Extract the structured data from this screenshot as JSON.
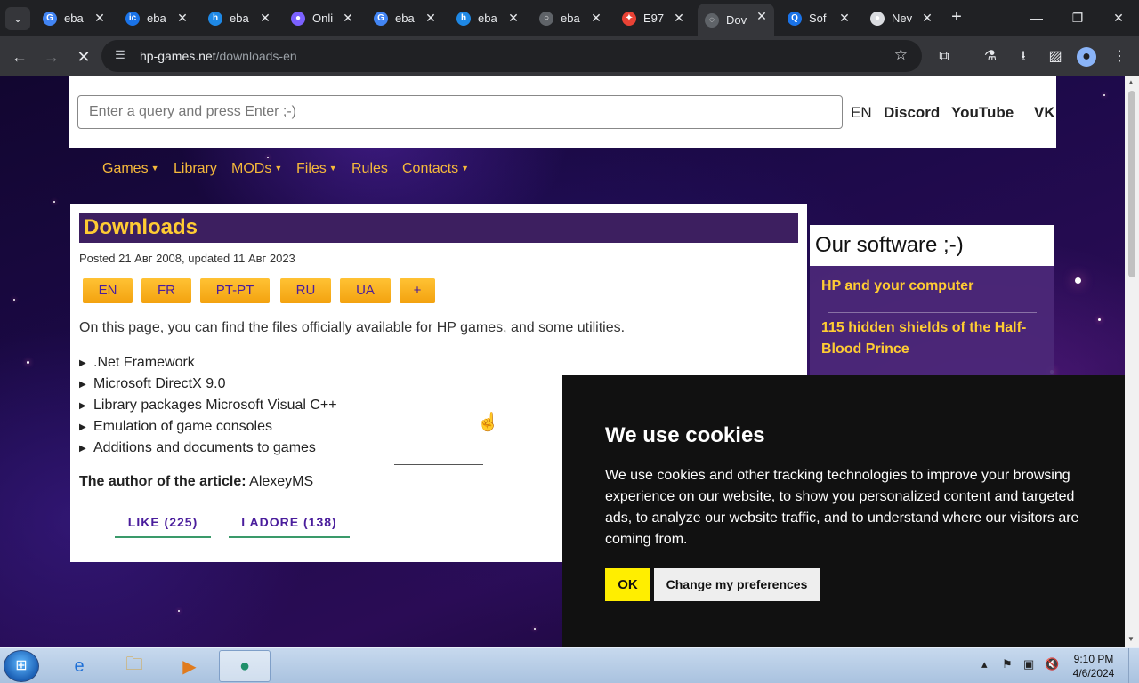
{
  "browser": {
    "tabs": [
      {
        "title": "eba",
        "icon": "google-icon",
        "color": "#4285f4",
        "glyph": "G"
      },
      {
        "title": "eba",
        "icon": "ic-icon",
        "color": "#1a73e8",
        "glyph": "ic"
      },
      {
        "title": "eba",
        "icon": "h-icon",
        "color": "#1e88e5",
        "glyph": "h"
      },
      {
        "title": "Onli",
        "icon": "onl-icon",
        "color": "#7b61ff",
        "glyph": "●"
      },
      {
        "title": "eba",
        "icon": "google-icon",
        "color": "#4285f4",
        "glyph": "G"
      },
      {
        "title": "eba",
        "icon": "h-icon",
        "color": "#1e88e5",
        "glyph": "h"
      },
      {
        "title": "eba",
        "icon": "globe-icon",
        "color": "#5f6368",
        "glyph": "○"
      },
      {
        "title": "E97",
        "icon": "pinwheel-icon",
        "color": "#e94235",
        "glyph": "✦"
      },
      {
        "title": "Dov",
        "icon": "loading-icon",
        "color": "#5f6368",
        "glyph": "◌",
        "active": true
      },
      {
        "title": "Sof",
        "icon": "q-icon",
        "color": "#1a73e8",
        "glyph": "Q"
      },
      {
        "title": "Nev",
        "icon": "chat-icon",
        "color": "#dadce0",
        "glyph": "●"
      }
    ],
    "url_domain": "hp-games.net",
    "url_path": "/downloads-en",
    "window_controls": {
      "minimize": "—",
      "restore": "❐",
      "close": "✕"
    }
  },
  "site": {
    "search_placeholder": "Enter a query and press Enter ;-)",
    "top_links": [
      "EN",
      "Discord",
      "YouTube",
      "VK"
    ],
    "menu": [
      {
        "label": "Games",
        "caret": true
      },
      {
        "label": "Library",
        "caret": false
      },
      {
        "label": "MODs",
        "caret": true
      },
      {
        "label": "Files",
        "caret": true
      },
      {
        "label": "Rules",
        "caret": false
      },
      {
        "label": "Contacts",
        "caret": true
      }
    ]
  },
  "article": {
    "title": "Downloads",
    "posted": "Posted 21 Авг 2008, updated 11 Авг 2023",
    "languages": [
      "EN",
      "FR",
      "PT-PT",
      "RU",
      "UA",
      "+"
    ],
    "intro": "On this page, you can find the files officially available for HP games, and some utilities.",
    "sections": [
      ".Net Framework",
      "Microsoft DirectX 9.0",
      "Library packages Microsoft Visual C++",
      "Emulation of game consoles",
      "Additions and documents to games"
    ],
    "author_label": "The author of the article:",
    "author_name": "AlexeyMS",
    "like_label": "LIKE (225)",
    "adore_label": "I ADORE (138)"
  },
  "sidebar": {
    "title": "Our software ;-)",
    "links": [
      "HP and your computer",
      "115 hidden shields of the Half-Blood Prince"
    ]
  },
  "cookie": {
    "title": "We use cookies",
    "text": "We use cookies and other tracking technologies to improve your browsing experience on our website, to show you personalized content and targeted ads, to analyze our website traffic, and to understand where our visitors are coming from.",
    "ok": "OK",
    "preferences": "Change my preferences"
  },
  "taskbar": {
    "time": "9:10 PM",
    "date": "4/6/2024",
    "apps": [
      "ie-icon",
      "explorer-icon",
      "media-player-icon",
      "chrome-app-icon"
    ]
  }
}
